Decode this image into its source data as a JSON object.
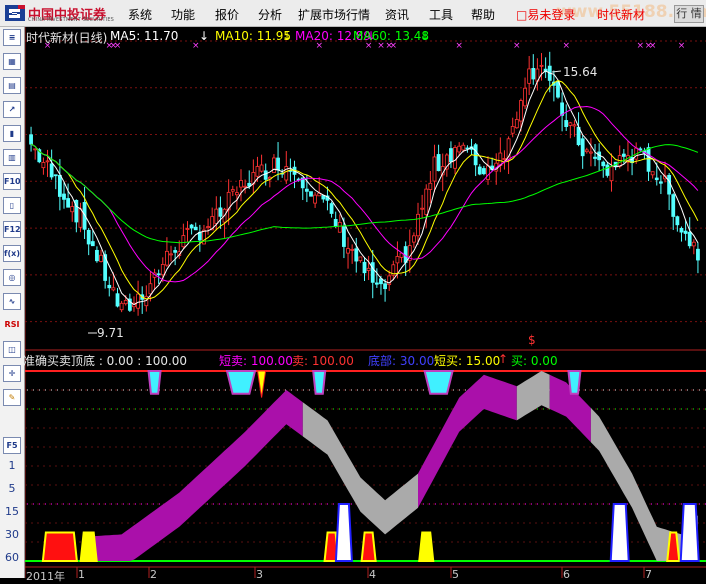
{
  "app": {
    "logo_cn": "中国中投证券",
    "logo_en": "CHINA INVESTMENT SECURITIES",
    "window_button": "行 情"
  },
  "menu": [
    "系统",
    "功能",
    "报价",
    "分析",
    "扩展市场行情",
    "资讯",
    "工具",
    "帮助"
  ],
  "status_left": "□易未登录",
  "status_right": "时代新材",
  "watermark": "www.55188.com",
  "upper": {
    "name_label": "时代新材(日线)",
    "ma5": "MA5: 11.70",
    "ma10": "MA10: 11.95",
    "ma20": "MA20: 12.89",
    "ma60": "MA60: 13.48",
    "high_label": "15.64",
    "low_label": "9.71",
    "signal_glyph": "$",
    "colors": {
      "ma5": "#ffffff",
      "ma10": "#ffff00",
      "ma20": "#ff00ff",
      "ma60": "#00ff00",
      "up": "#ff3232",
      "down": "#54ffff"
    }
  },
  "lower": {
    "title": "准确买卖顶底 : 0.00 : 100.00",
    "items": [
      {
        "label": "短卖: 100.00",
        "color": "#ff00ff"
      },
      {
        "label": "卖: 100.00",
        "color": "#ff3232"
      },
      {
        "label": "底部: 30.00",
        "color": "#4040ff"
      },
      {
        "label": "短买: 15.00",
        "color": "#ffff00"
      },
      {
        "label": "买: 0.00",
        "color": "#00ff00"
      }
    ]
  },
  "x_axis": {
    "year_label": "2011年",
    "month_labels": [
      "1",
      "2",
      "3",
      "4",
      "5",
      "6",
      "7"
    ]
  },
  "toolbar": {
    "buttons": [
      "list-icon",
      "grid-icon",
      "table-icon",
      "line-chart-icon",
      "candle-icon",
      "bar-icon",
      "F10",
      "doc-icon",
      "F12",
      "fx",
      "magnifier-icon",
      "wave-icon",
      "RSI",
      "overlay-icon",
      "cross-icon",
      "pen-icon"
    ],
    "f5": "F5",
    "periods": [
      "1",
      "5",
      "15",
      "30",
      "60"
    ]
  },
  "chart_data": {
    "type": "candlestick",
    "title": "时代新材(日线)",
    "moving_averages": {
      "MA5": 11.7,
      "MA10": 11.95,
      "MA20": 12.89,
      "MA60": 13.48
    },
    "price_high": 15.64,
    "price_low": 9.71,
    "y_range": [
      9.5,
      16.0
    ],
    "x_categories": [
      "1",
      "2",
      "3",
      "4",
      "5",
      "6",
      "7"
    ],
    "indicator": {
      "name": "准确买卖顶底",
      "values": {
        "短卖": 100.0,
        "卖": 100.0,
        "底部": 30.0,
        "短买": 15.0,
        "买": 0.0
      },
      "reference_levels": [
        0,
        15,
        30,
        100
      ],
      "range": [
        0,
        100
      ]
    }
  }
}
